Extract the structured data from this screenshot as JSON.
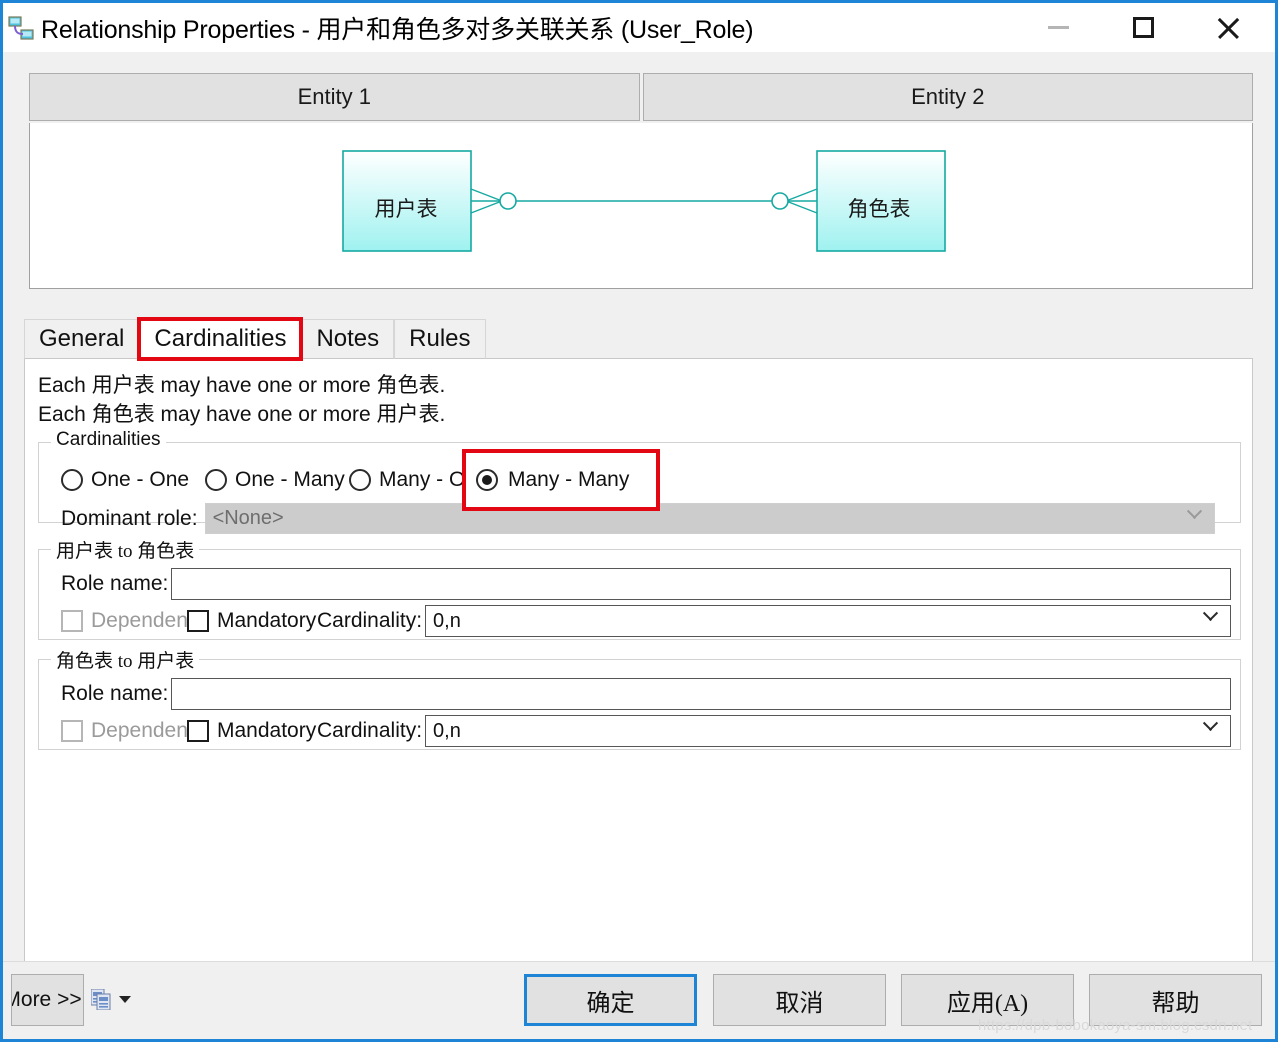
{
  "window": {
    "title": "Relationship Properties - 用户和角色多对多关联关系 (User_Role)",
    "icon": "relationship-icon",
    "controls": {
      "minimize": "minimize-icon",
      "maximize": "maximize-icon",
      "close": "close-icon"
    }
  },
  "preview": {
    "header": {
      "entity1": "Entity 1",
      "entity2": "Entity 2"
    },
    "diagram": {
      "entity1_label": "用户表",
      "entity2_label": "角色表",
      "notation": "crow-foot-zero-or-many",
      "line_color": "#17a8a0",
      "box_fill_top": "#ffffff",
      "box_fill_bottom": "#9ff2f0"
    }
  },
  "tabs": [
    {
      "label": "General",
      "active": false,
      "highlighted": false
    },
    {
      "label": "Cardinalities",
      "active": true,
      "highlighted": true
    },
    {
      "label": "Notes",
      "active": false,
      "highlighted": false
    },
    {
      "label": "Rules",
      "active": false,
      "highlighted": false
    }
  ],
  "summary": {
    "line1_pre": "Each ",
    "line1_a": "用户表",
    "line1_mid": " may have one or more ",
    "line1_b": "角色表",
    "line1_end": ".",
    "line2_pre": "Each ",
    "line2_a": "角色表",
    "line2_mid": " may have one or more ",
    "line2_b": "用户表",
    "line2_end": "."
  },
  "cardinalities_group": {
    "title": "Cardinalities",
    "options": [
      {
        "label": "One - One",
        "checked": false
      },
      {
        "label": "One - Many",
        "checked": false
      },
      {
        "label": "Many - One",
        "checked": false
      },
      {
        "label": "Many - Many",
        "checked": true
      }
    ],
    "highlight_color": "#e30613",
    "dominant_role": {
      "label": "Dominant role:",
      "value": "<None>",
      "disabled": true
    }
  },
  "role_a_to_b": {
    "title": "用户表 to 角色表",
    "role_name_label": "Role name:",
    "role_name_value": "",
    "dependent_label": "Dependent",
    "dependent_checked": false,
    "dependent_disabled": true,
    "mandatory_label": "Mandatory",
    "mandatory_checked": false,
    "cardinality_label": "Cardinality:",
    "cardinality_value": "0,n"
  },
  "role_b_to_a": {
    "title": "角色表 to 用户表",
    "role_name_label": "Role name:",
    "role_name_value": "",
    "dependent_label": "Dependent",
    "dependent_checked": false,
    "dependent_disabled": true,
    "mandatory_label": "Mandatory",
    "mandatory_checked": false,
    "cardinality_label": "Cardinality:",
    "cardinality_value": "0,n"
  },
  "footer": {
    "more_label": "More >>",
    "report_icon": "report-icon",
    "report_caret": "caret-down-icon",
    "ok_label": "确定",
    "cancel_label": "取消",
    "apply_label": "应用(A)",
    "help_label": "帮助"
  },
  "watermark": "https://dpb-bobokaoya-sm.blog.csdn.net"
}
